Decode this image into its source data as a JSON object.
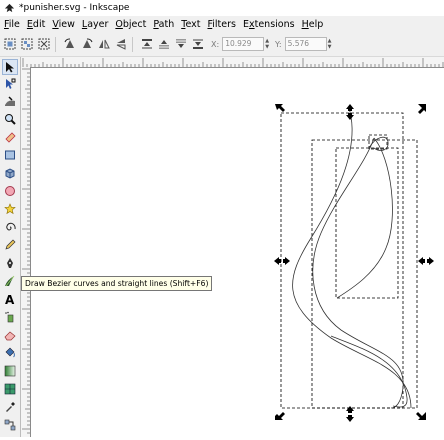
{
  "window": {
    "title": "*punisher.svg - Inkscape",
    "app_icon": "inkscape-icon"
  },
  "menubar": {
    "items": [
      {
        "label": "File",
        "mnemonic": "F",
        "rest": "ile"
      },
      {
        "label": "Edit",
        "mnemonic": "E",
        "rest": "dit"
      },
      {
        "label": "View",
        "mnemonic": "V",
        "rest": "iew"
      },
      {
        "label": "Layer",
        "mnemonic": "L",
        "rest": "ayer"
      },
      {
        "label": "Object",
        "mnemonic": "O",
        "rest": "bject"
      },
      {
        "label": "Path",
        "mnemonic": "P",
        "rest": "ath"
      },
      {
        "label": "Text",
        "mnemonic": "T",
        "rest": "ext"
      },
      {
        "label": "Filters",
        "mnemonic": "F",
        "rest": "ilters"
      },
      {
        "label": "Extensions",
        "mnemonic": "x",
        "pre": "E",
        "rest": "tensions"
      },
      {
        "label": "Help",
        "mnemonic": "H",
        "rest": "elp"
      }
    ]
  },
  "toolbar": {
    "x_label": "X:",
    "x_value": "10.929",
    "y_label": "Y:",
    "y_value": "5.576",
    "buttons": [
      "select-all-icon",
      "select-all-in-all-layers-icon",
      "deselect-icon",
      "rotate-ccw-icon",
      "rotate-cw-icon",
      "flip-horizontal-icon",
      "flip-vertical-icon",
      "raise-to-top-icon",
      "raise-icon",
      "lower-icon",
      "lower-to-bottom-icon"
    ]
  },
  "toolbox": {
    "tools": [
      "selector-icon",
      "node-editor-icon",
      "tweak-icon",
      "zoom-icon",
      "measure-icon",
      "rectangle-icon",
      "box-3d-icon",
      "ellipse-icon",
      "star-icon",
      "spiral-icon",
      "pencil-icon",
      "bezier-pen-icon",
      "calligraphy-icon",
      "text-icon",
      "spray-icon",
      "eraser-icon",
      "paint-bucket-icon",
      "gradient-icon",
      "mesh-icon",
      "dropper-icon",
      "connector-icon"
    ],
    "active_tool": "selector-icon",
    "hovered_tool": "calligraphy-icon"
  },
  "tooltip": {
    "text": "Draw Bezier curves and straight lines (Shift+F6)"
  },
  "colors": {
    "chrome": "#f0f0f0",
    "canvas": "#ffffff",
    "tooltip_bg": "#ffffe8",
    "selection_dash": "#000000",
    "active_tool_bg": "#dbe6f4"
  }
}
